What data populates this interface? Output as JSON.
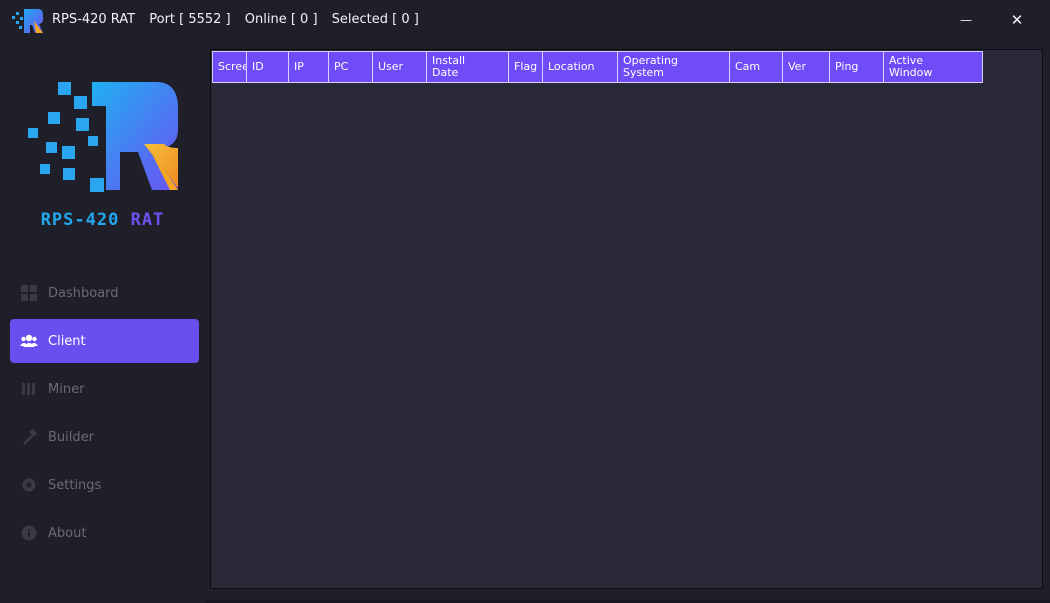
{
  "window": {
    "app_name": "RPS-420 RAT",
    "port": "Port [ 5552 ]",
    "online": "Online [ 0 ]",
    "selected": "Selected [ 0 ]",
    "minimize_glyph": "—",
    "close_glyph": "✕"
  },
  "brand": {
    "part1": "RPS-420",
    "part2": " RAT",
    "colors": {
      "blue": "#22a8f0",
      "purple": "#6b52f2",
      "orange": "#f5a623"
    }
  },
  "sidebar": {
    "items": [
      {
        "label": "Dashboard",
        "icon": "dashboard-icon",
        "active": false
      },
      {
        "label": "Client",
        "icon": "users-icon",
        "active": true
      },
      {
        "label": "Miner",
        "icon": "miner-icon",
        "active": false
      },
      {
        "label": "Builder",
        "icon": "hammer-icon",
        "active": false
      },
      {
        "label": "Settings",
        "icon": "gear-icon",
        "active": false
      },
      {
        "label": "About",
        "icon": "info-icon",
        "active": false
      }
    ]
  },
  "table": {
    "columns": [
      {
        "label": "Screen"
      },
      {
        "label": "ID"
      },
      {
        "label": "IP"
      },
      {
        "label": "PC"
      },
      {
        "label": "User"
      },
      {
        "label": "Install\nDate"
      },
      {
        "label": "Flag"
      },
      {
        "label": "Location"
      },
      {
        "label": "Operating\nSystem"
      },
      {
        "label": "Cam"
      },
      {
        "label": "Ver"
      },
      {
        "label": "Ping"
      },
      {
        "label": "Active\nWindow"
      }
    ],
    "rows": []
  },
  "colors": {
    "accent": "#6b4ef0",
    "background": "#1f1f29",
    "panel": "#292836"
  }
}
